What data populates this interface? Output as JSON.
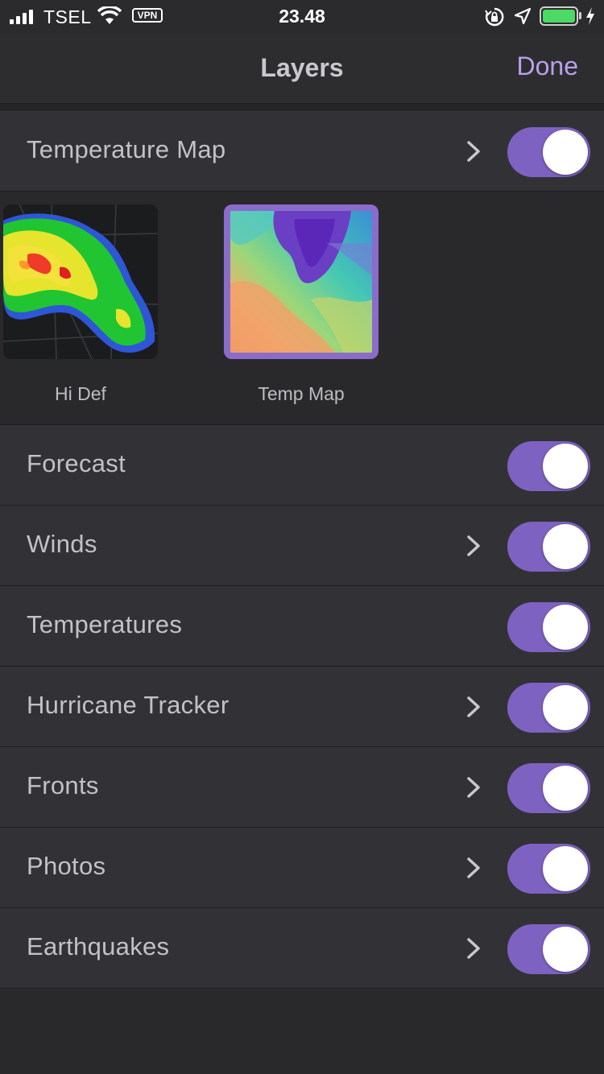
{
  "status_bar": {
    "carrier": "TSEL",
    "vpn": "VPN",
    "time": "23.48",
    "battery_color": "#4cd964"
  },
  "nav": {
    "title": "Layers",
    "done_label": "Done",
    "accent": "#b9a0e9"
  },
  "layers": {
    "temperature_map": {
      "label": "Temperature Map",
      "enabled": true,
      "has_detail": true
    },
    "styles": [
      {
        "label": "Hi Def",
        "selected": false
      },
      {
        "label": "Temp Map",
        "selected": true
      }
    ],
    "items": [
      {
        "label": "Forecast",
        "enabled": true,
        "has_detail": false
      },
      {
        "label": "Winds",
        "enabled": true,
        "has_detail": true
      },
      {
        "label": "Temperatures",
        "enabled": true,
        "has_detail": false
      },
      {
        "label": "Hurricane Tracker",
        "enabled": true,
        "has_detail": true
      },
      {
        "label": "Fronts",
        "enabled": true,
        "has_detail": true
      },
      {
        "label": "Photos",
        "enabled": true,
        "has_detail": true
      },
      {
        "label": "Earthquakes",
        "enabled": true,
        "has_detail": true
      }
    ]
  },
  "toggle_color": "#7e62c1"
}
